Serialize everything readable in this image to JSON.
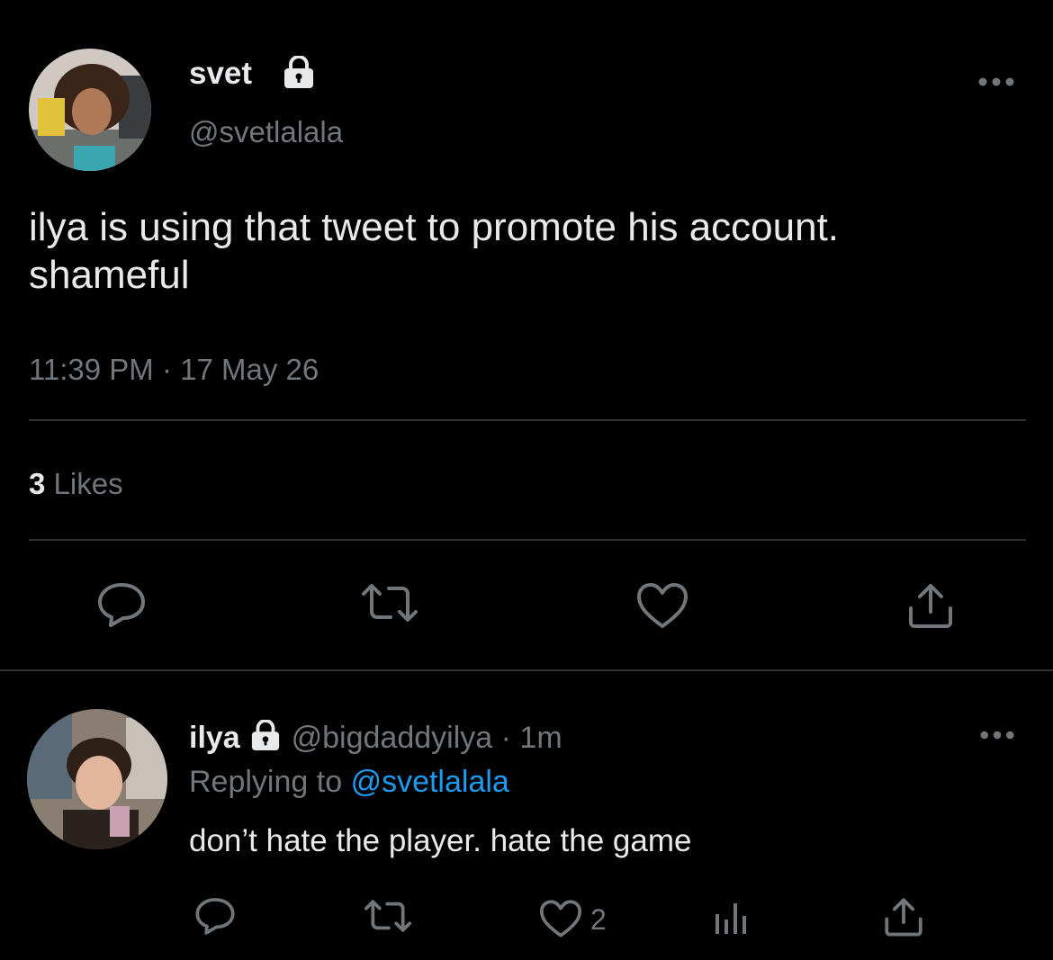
{
  "main_tweet": {
    "display_name": "svet",
    "handle": "@svetlalala",
    "text_line1": "ilya is using that tweet to promote his account.",
    "text_line2": "shameful",
    "time": "11:39 PM",
    "date_sep": "·",
    "date": "17 May 26",
    "likes_count": "3",
    "likes_label": "Likes",
    "protected_icon": "lock-icon",
    "more_icon": "more-icon"
  },
  "reply": {
    "display_name": "ilya",
    "handle": "@bigdaddyilya",
    "sep": "·",
    "time_ago": "1m",
    "replying_prefix": "Replying to",
    "replying_handle": "@svetlalala",
    "text": "don’t hate the player. hate the game",
    "like_count": "2",
    "protected_icon": "lock-icon",
    "more_icon": "more-icon"
  },
  "actions": {
    "main": [
      "reply-icon",
      "retweet-icon",
      "like-icon",
      "share-icon"
    ],
    "reply": [
      "reply-icon",
      "retweet-icon",
      "like-icon",
      "analytics-icon",
      "share-icon"
    ]
  },
  "colors": {
    "background": "#000000",
    "text": "#e7e9ea",
    "muted": "#71767b",
    "link": "#1d9bf0",
    "divider": "#2f3336"
  }
}
